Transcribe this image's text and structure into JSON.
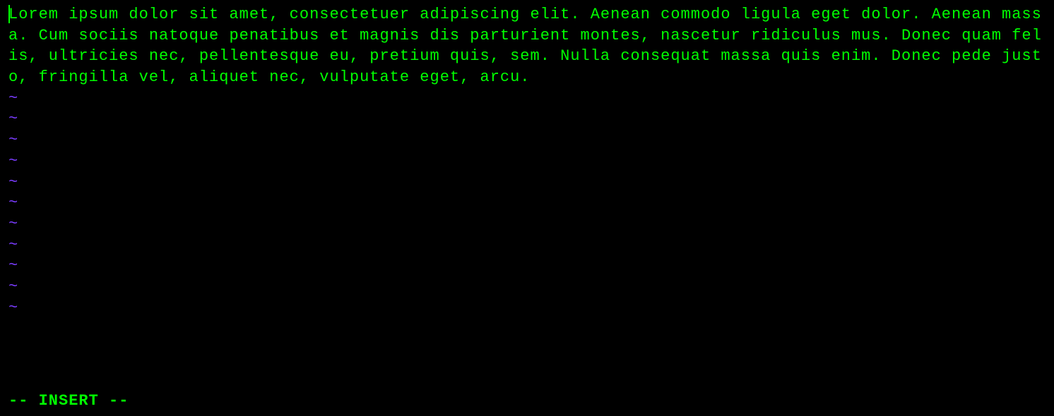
{
  "colors": {
    "background": "#000000",
    "text": "#00ff00",
    "tilde": "#7a3cff"
  },
  "buffer": {
    "content": "Lorem ipsum dolor sit amet, consectetuer adipiscing elit. Aenean commodo ligula eget dolor. Aenean massa. Cum sociis natoque penatibus et magnis dis parturient montes, nascetur ridiculus mus. Donec quam felis, ultricies nec, pellentesque eu, pretium quis, sem. Nulla consequat massa quis enim. Donec pede justo, fringilla vel, aliquet nec, vulputate eget, arcu."
  },
  "empty_line_marker": "~",
  "empty_line_count": 11,
  "status": {
    "mode": "-- INSERT --"
  }
}
